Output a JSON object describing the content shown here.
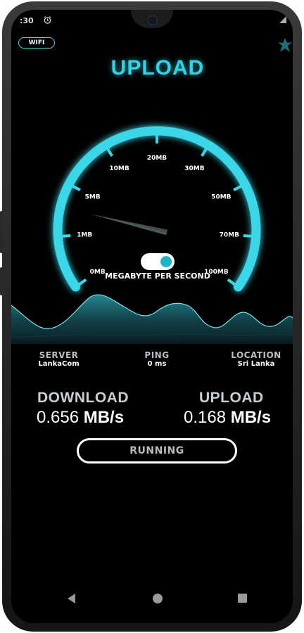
{
  "status_bar": {
    "time": ":30"
  },
  "header": {
    "network_badge": "WIFI",
    "title": "UPLOAD"
  },
  "gauge": {
    "ticks": [
      "0MB",
      "1MB",
      "5MB",
      "10MB",
      "20MB",
      "30MB",
      "50MB",
      "70MB",
      "100MB"
    ],
    "needle_tick_position": 1.55,
    "accent_color": "#35d2e4"
  },
  "toggle": {
    "on": true,
    "label": "MEGABYTE PER SECOND"
  },
  "info": {
    "server": {
      "label": "SERVER",
      "value": "LankaCom"
    },
    "ping": {
      "label": "PING",
      "value": "0 ms"
    },
    "location": {
      "label": "LOCATION",
      "value": "Sri Lanka"
    }
  },
  "results": {
    "download": {
      "label": "DOWNLOAD",
      "value": "0.656",
      "unit": "MB/s"
    },
    "upload": {
      "label": "UPLOAD",
      "value": "0.168",
      "unit": "MB/s"
    }
  },
  "action_button": {
    "label": "RUNNING"
  },
  "nav": {
    "icons": [
      "back-icon",
      "home-icon",
      "recents-icon"
    ]
  }
}
